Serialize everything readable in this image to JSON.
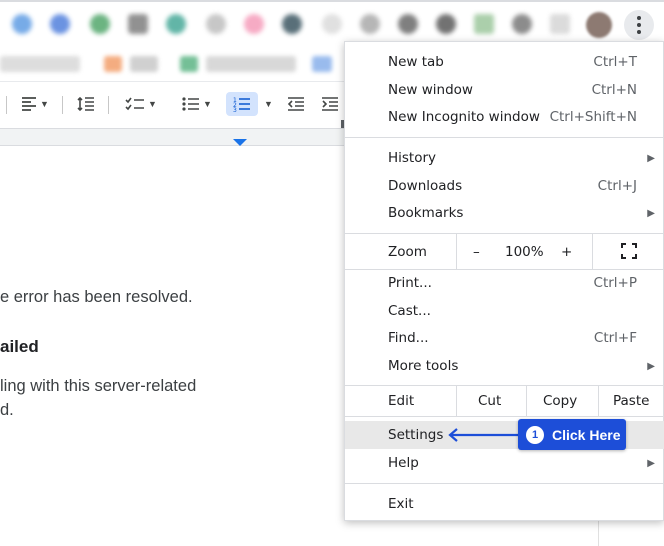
{
  "menu": {
    "new_tab": {
      "label": "New tab",
      "shortcut": "Ctrl+T"
    },
    "new_window": {
      "label": "New window",
      "shortcut": "Ctrl+N"
    },
    "new_incognito": {
      "label": "New Incognito window",
      "shortcut": "Ctrl+Shift+N"
    },
    "history": {
      "label": "History"
    },
    "downloads": {
      "label": "Downloads",
      "shortcut": "Ctrl+J"
    },
    "bookmarks": {
      "label": "Bookmarks"
    },
    "zoom": {
      "label": "Zoom",
      "minus": "–",
      "value": "100%",
      "plus": "+"
    },
    "print": {
      "label": "Print...",
      "shortcut": "Ctrl+P"
    },
    "cast": {
      "label": "Cast..."
    },
    "find": {
      "label": "Find...",
      "shortcut": "Ctrl+F"
    },
    "more_tools": {
      "label": "More tools"
    },
    "edit": {
      "label": "Edit",
      "cut": "Cut",
      "copy": "Copy",
      "paste": "Paste"
    },
    "settings": {
      "label": "Settings"
    },
    "help": {
      "label": "Help"
    },
    "exit": {
      "label": "Exit"
    }
  },
  "callout": {
    "number": "1",
    "label": "Click Here"
  },
  "document": {
    "line1": "e error has been resolved.",
    "heading": "ailed",
    "line2": "ling with this server-related",
    "line3": "d."
  },
  "colors": {
    "accent": "#1d4ed8",
    "highlight": "#e8e8e8"
  }
}
